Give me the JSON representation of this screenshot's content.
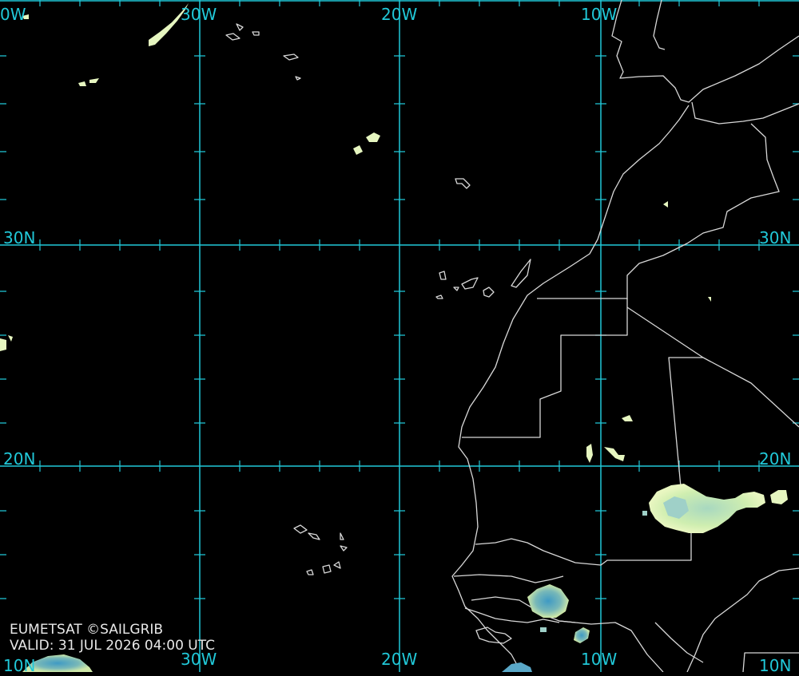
{
  "map": {
    "labels": {
      "top_40w": "0W",
      "top_30w": "30W",
      "top_20w": "20W",
      "top_10w": "10W",
      "left_30n": "30N",
      "right_30n": "30N",
      "left_20n": "20N",
      "right_20n": "20N",
      "bottom_30w": "30W",
      "bottom_20w": "20W",
      "bottom_10w": "10W",
      "bottom_left_10n": "10N",
      "bottom_right_10n": "10N"
    },
    "credit": "EUMETSAT ©SAILGRIB",
    "valid": "VALID:  31 JUL 2026 04:00 UTC",
    "colors": {
      "grid": "#21c8d8",
      "coast": "#d8d8d8",
      "cloud_light": "#d8f0b0",
      "cloud_blue": "#5aa8c8"
    }
  }
}
